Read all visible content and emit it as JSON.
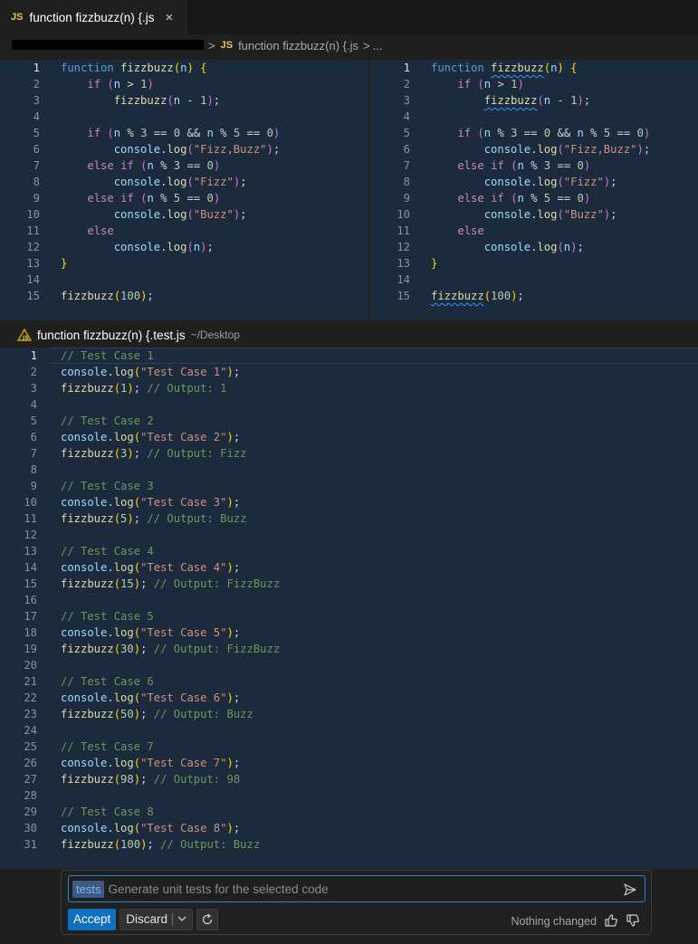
{
  "tab": {
    "icon_label": "JS",
    "name": "function fizzbuzz(n) {.js",
    "close_glyph": "×"
  },
  "breadcrumb": {
    "sep": ">",
    "icon_label": "JS",
    "file": "function fizzbuzz(n) {.js",
    "more": "..."
  },
  "diff_left_lines": [
    "1",
    "2",
    "3",
    "4",
    "5",
    "6",
    "7",
    "8",
    "9",
    "10",
    "11",
    "12",
    "13",
    "14",
    "15"
  ],
  "diff_code": {
    "l1a": "function",
    "l1b": "fizzbuzz",
    "l1c": "n",
    "l2a": "if",
    "l2b": "n",
    "l2c": "1",
    "l3a": "fizzbuzz",
    "l3b": "n",
    "l3c": "1",
    "l5a": "if",
    "l5b": "n",
    "l5c": "3",
    "l5d": "0",
    "l5e": "n",
    "l5f": "5",
    "l5g": "0",
    "l6a": "console",
    "l6b": "log",
    "l6c": "\"Fizz,Buzz\"",
    "l7a": "else",
    "l7b": "if",
    "l7c": "n",
    "l7d": "3",
    "l7e": "0",
    "l8a": "console",
    "l8b": "log",
    "l8c": "\"Fizz\"",
    "l9a": "else",
    "l9b": "if",
    "l9c": "n",
    "l9d": "5",
    "l9e": "0",
    "l10a": "console",
    "l10b": "log",
    "l10c": "\"Buzz\"",
    "l11a": "else",
    "l12a": "console",
    "l12b": "log",
    "l12c": "n",
    "l15a": "fizzbuzz",
    "l15b": "100"
  },
  "test_header": {
    "title": "function fizzbuzz(n) {.test.js",
    "path": "~/Desktop"
  },
  "test_lines": [
    {
      "n": "1",
      "t": "comment",
      "text": "// Test Case 1"
    },
    {
      "n": "2",
      "t": "log",
      "arg": "\"Test Case 1\""
    },
    {
      "n": "3",
      "t": "call",
      "arg": "1",
      "comment": "// Output: 1"
    },
    {
      "n": "4",
      "t": "blank"
    },
    {
      "n": "5",
      "t": "comment",
      "text": "// Test Case 2"
    },
    {
      "n": "6",
      "t": "log",
      "arg": "\"Test Case 2\""
    },
    {
      "n": "7",
      "t": "call",
      "arg": "3",
      "comment": "// Output: Fizz"
    },
    {
      "n": "8",
      "t": "blank"
    },
    {
      "n": "9",
      "t": "comment",
      "text": "// Test Case 3"
    },
    {
      "n": "10",
      "t": "log",
      "arg": "\"Test Case 3\""
    },
    {
      "n": "11",
      "t": "call",
      "arg": "5",
      "comment": "// Output: Buzz"
    },
    {
      "n": "12",
      "t": "blank"
    },
    {
      "n": "13",
      "t": "comment",
      "text": "// Test Case 4"
    },
    {
      "n": "14",
      "t": "log",
      "arg": "\"Test Case 4\""
    },
    {
      "n": "15",
      "t": "call",
      "arg": "15",
      "comment": "// Output: FizzBuzz"
    },
    {
      "n": "16",
      "t": "blank"
    },
    {
      "n": "17",
      "t": "comment",
      "text": "// Test Case 5"
    },
    {
      "n": "18",
      "t": "log",
      "arg": "\"Test Case 5\""
    },
    {
      "n": "19",
      "t": "call",
      "arg": "30",
      "comment": "// Output: FizzBuzz"
    },
    {
      "n": "20",
      "t": "blank"
    },
    {
      "n": "21",
      "t": "comment",
      "text": "// Test Case 6"
    },
    {
      "n": "22",
      "t": "log",
      "arg": "\"Test Case 6\""
    },
    {
      "n": "23",
      "t": "call",
      "arg": "50",
      "comment": "// Output: Buzz"
    },
    {
      "n": "24",
      "t": "blank"
    },
    {
      "n": "25",
      "t": "comment",
      "text": "// Test Case 7"
    },
    {
      "n": "26",
      "t": "log",
      "arg": "\"Test Case 7\""
    },
    {
      "n": "27",
      "t": "call",
      "arg": "98",
      "comment": "// Output: 98"
    },
    {
      "n": "28",
      "t": "blank"
    },
    {
      "n": "29",
      "t": "comment",
      "text": "// Test Case 8"
    },
    {
      "n": "30",
      "t": "log",
      "arg": "\"Test Case 8\""
    },
    {
      "n": "31",
      "t": "call",
      "arg": "100",
      "comment": "// Output: Buzz"
    }
  ],
  "test_tokens": {
    "console": "console",
    "log": "log",
    "fizzbuzz": "fizzbuzz"
  },
  "chat": {
    "command": "tests",
    "placeholder": "Generate unit tests for the selected code",
    "accept_label": "Accept",
    "discard_label": "Discard",
    "status": "Nothing changed"
  },
  "icons": {
    "send": "send-icon",
    "rerun": "refresh-icon",
    "thumbs_up": "thumbs-up-icon",
    "thumbs_down": "thumbs-down-icon",
    "warning": "warning-icon"
  },
  "colors": {
    "accent": "#0e70c0",
    "editor_bg": "#1c2a3d",
    "keyword": "#c586c0",
    "function": "#dcdcaa",
    "string": "#ce9178",
    "comment": "#6a9955",
    "js_icon": "#e8c84a"
  }
}
